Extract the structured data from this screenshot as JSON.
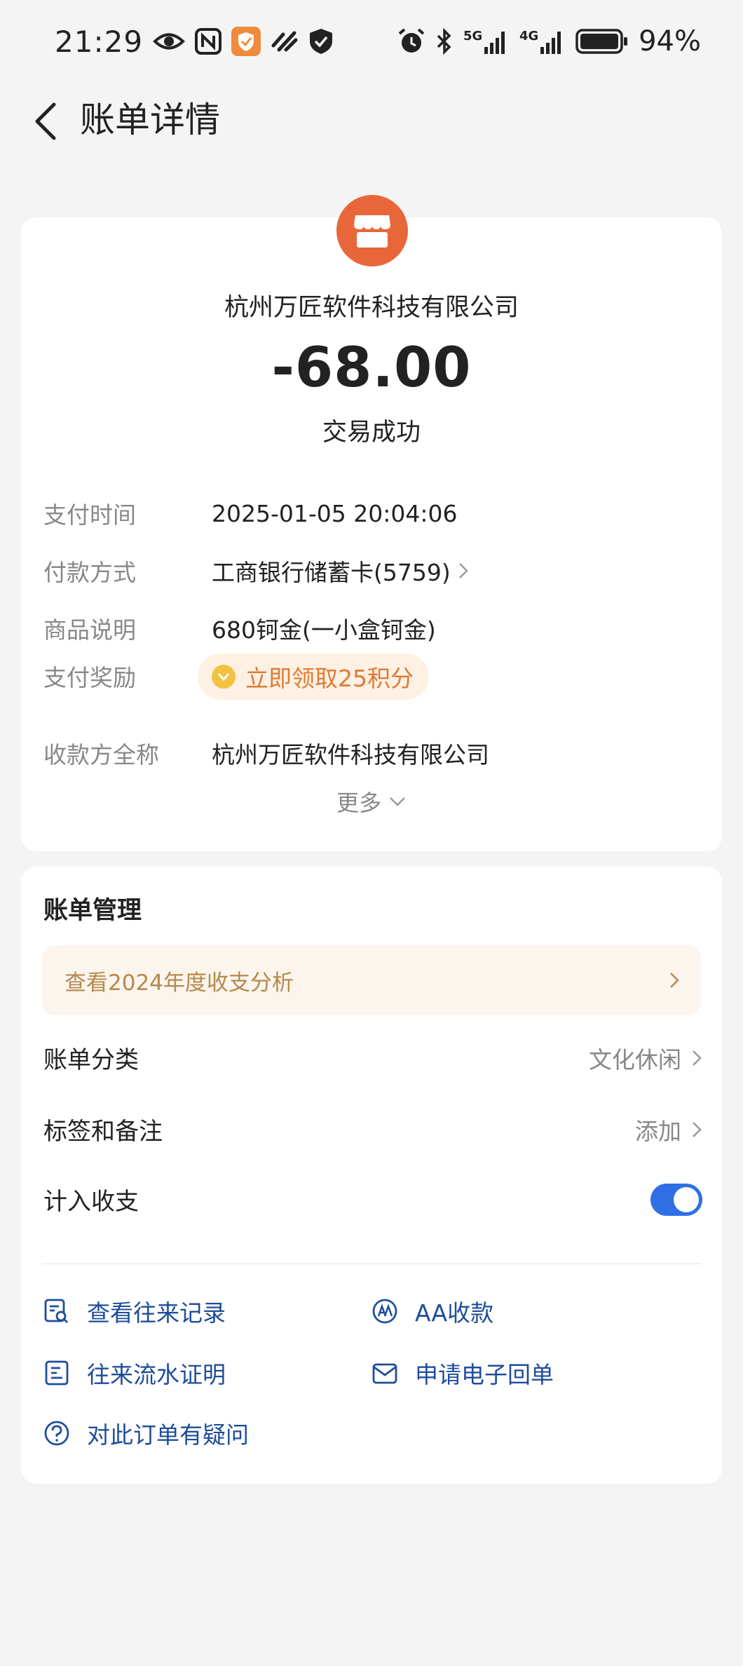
{
  "status_bar": {
    "time": "21:29",
    "battery_pct": "94%",
    "net_5g": "5G",
    "net_4g": "4G",
    "icons": [
      "eye-icon",
      "nfc-icon",
      "app-shield-icon",
      "pay-icon",
      "security-shield-icon",
      "alarm-icon",
      "bluetooth-icon",
      "signal-5g-icon",
      "signal-4g-icon",
      "battery-icon"
    ]
  },
  "header": {
    "title": "账单详情"
  },
  "bill": {
    "merchant_name": "杭州万匠软件科技有限公司",
    "amount": "-68.00",
    "status": "交易成功",
    "rows": [
      {
        "label": "支付时间",
        "value": "2025-01-05 20:04:06"
      },
      {
        "label": "付款方式",
        "value": "工商银行储蓄卡(5759)"
      },
      {
        "label": "商品说明",
        "value": "680钶金(一小盒钶金)"
      },
      {
        "label": "支付奖励",
        "value": "立即领取25积分"
      },
      {
        "label": "收款方全称",
        "value": "杭州万匠软件科技有限公司"
      }
    ],
    "more_label": "更多",
    "accent_color": "#e8673a"
  },
  "management": {
    "title": "账单管理",
    "annual_banner": "查看2024年度收支分析",
    "category_label": "账单分类",
    "category_value": "文化休闲",
    "tags_label": "标签和备注",
    "tags_value": "添加",
    "count_label": "计入收支",
    "count_enabled": true,
    "actions": [
      {
        "label": "查看往来记录",
        "icon": "record-search-icon"
      },
      {
        "label": "AA收款",
        "icon": "aa-icon"
      },
      {
        "label": "往来流水证明",
        "icon": "statement-icon"
      },
      {
        "label": "申请电子回单",
        "icon": "mail-icon"
      },
      {
        "label": "对此订单有疑问",
        "icon": "question-icon"
      }
    ]
  }
}
